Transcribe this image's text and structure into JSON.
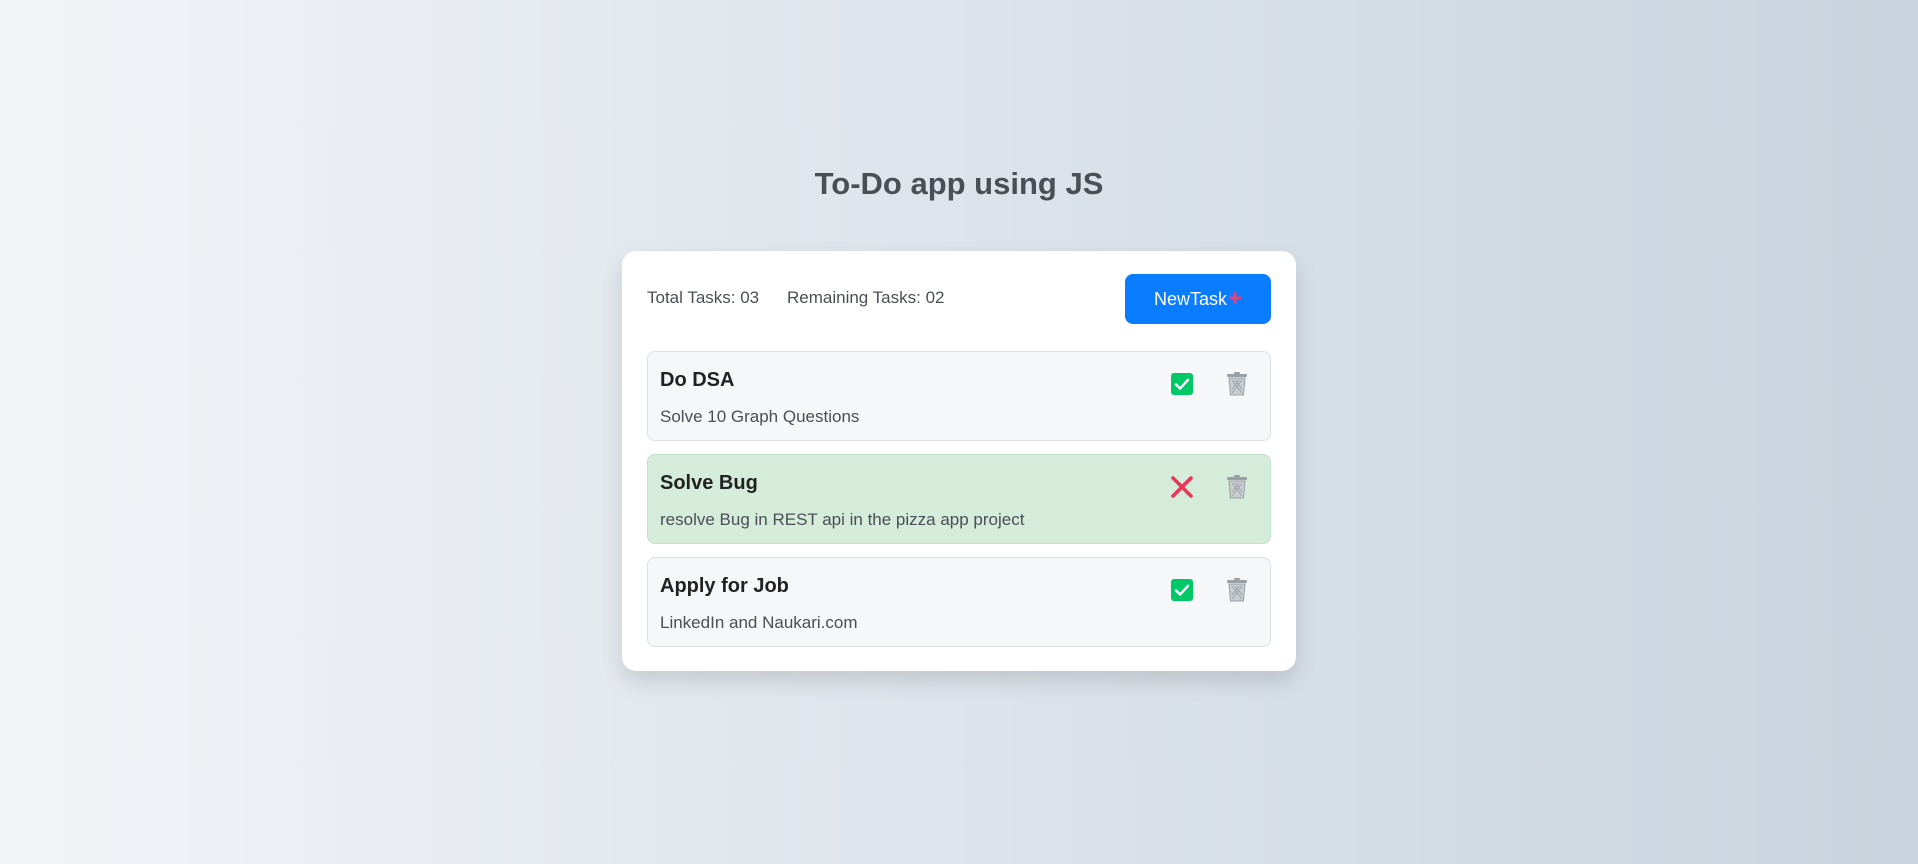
{
  "page": {
    "title": "To-Do app using JS"
  },
  "stats": {
    "total_label": "Total Tasks: 03",
    "remaining_label": "Remaining Tasks: 02"
  },
  "new_task_button": {
    "label": "NewTask",
    "icon": "plus-icon",
    "icon_glyph": "+"
  },
  "tasks": [
    {
      "title": "Do DSA",
      "description": "Solve 10 Graph Questions",
      "completed": false,
      "action_icon": "checkbox-checked-icon"
    },
    {
      "title": "Solve Bug",
      "description": "resolve Bug in REST api in the pizza app project",
      "completed": true,
      "action_icon": "close-icon"
    },
    {
      "title": "Apply for Job",
      "description": "LinkedIn and Naukari.com",
      "completed": false,
      "action_icon": "checkbox-checked-icon"
    }
  ],
  "colors": {
    "accent_blue": "#0a7cff",
    "plus_pink": "#e8407a",
    "check_green": "#00c866",
    "cross_red": "#ec3659",
    "done_bg": "#d4ecd9",
    "trash_gray": "#9aa0a6"
  }
}
